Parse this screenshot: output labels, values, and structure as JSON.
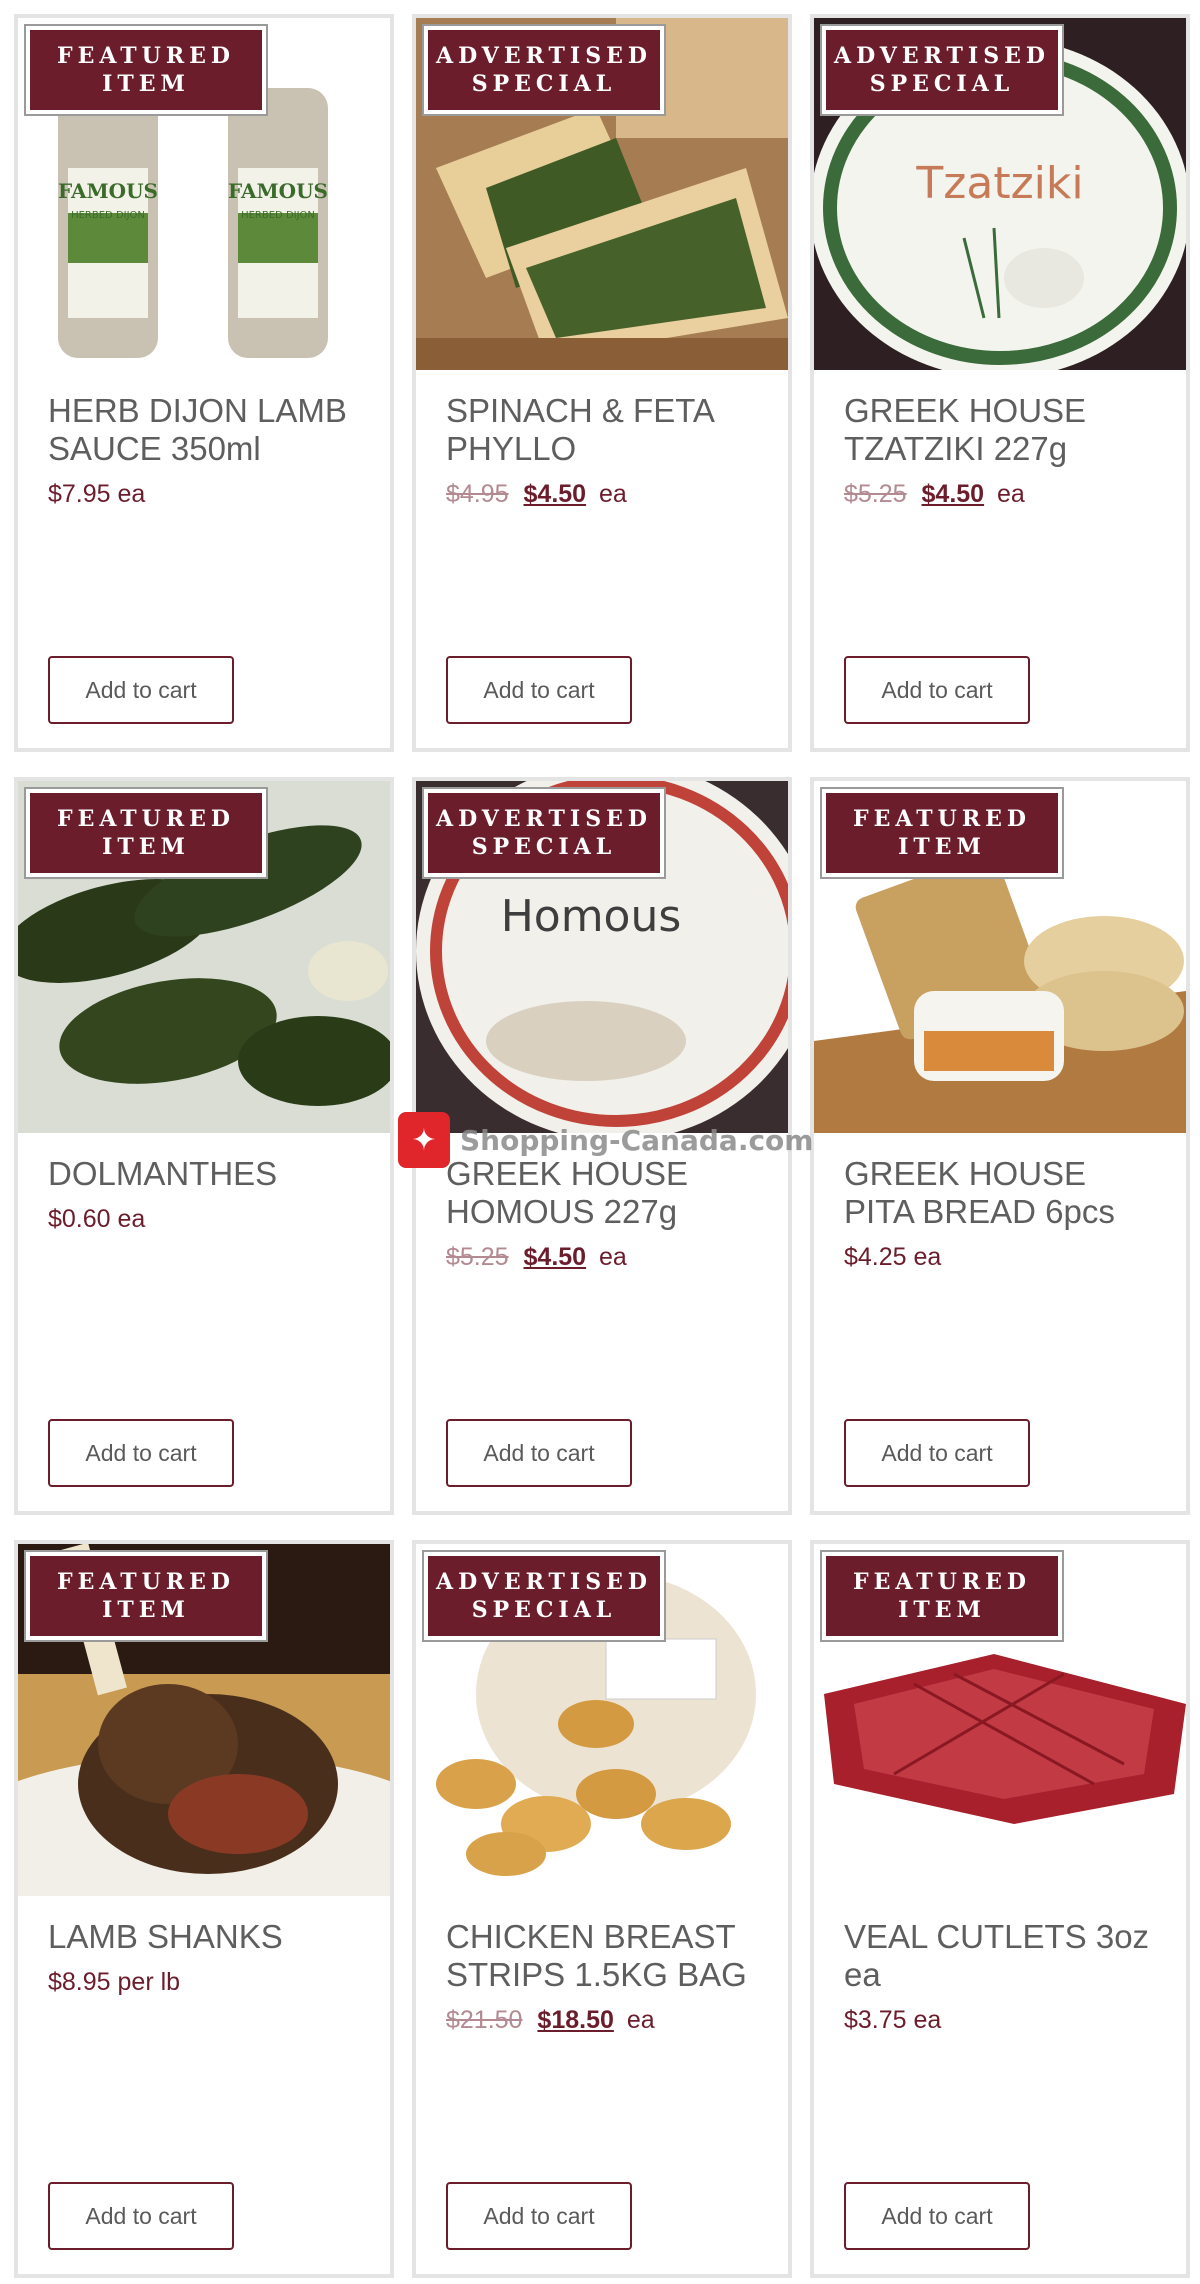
{
  "products": [
    {
      "badge1": "FEATURED",
      "badge2": "ITEM",
      "title": "HERB DIJON LAMB SAUCE 350ml",
      "old_price": "",
      "price": "$7.95",
      "unit": "ea",
      "cart": "Add to cart"
    },
    {
      "badge1": "ADVERTISED",
      "badge2": "SPECIAL",
      "title": "SPINACH & FETA PHYLLO",
      "old_price": "$4.95",
      "price": "$4.50",
      "unit": "ea",
      "cart": "Add to cart"
    },
    {
      "badge1": "ADVERTISED",
      "badge2": "SPECIAL",
      "title": "GREEK HOUSE TZATZIKI 227g",
      "old_price": "$5.25",
      "price": "$4.50",
      "unit": "ea",
      "cart": "Add to cart"
    },
    {
      "badge1": "FEATURED",
      "badge2": "ITEM",
      "title": "DOLMANTHES",
      "old_price": "",
      "price": "$0.60",
      "unit": "ea",
      "cart": "Add to cart"
    },
    {
      "badge1": "ADVERTISED",
      "badge2": "SPECIAL",
      "title": "GREEK HOUSE HOMOUS 227g",
      "old_price": "$5.25",
      "price": "$4.50",
      "unit": "ea",
      "cart": "Add to cart"
    },
    {
      "badge1": "FEATURED",
      "badge2": "ITEM",
      "title": "GREEK HOUSE PITA BREAD 6pcs",
      "old_price": "",
      "price": "$4.25",
      "unit": "ea",
      "cart": "Add to cart"
    },
    {
      "badge1": "FEATURED",
      "badge2": "ITEM",
      "title": "LAMB SHANKS",
      "old_price": "",
      "price": "$8.95",
      "unit": "per lb",
      "cart": "Add to cart"
    },
    {
      "badge1": "ADVERTISED",
      "badge2": "SPECIAL",
      "title": "CHICKEN BREAST STRIPS 1.5KG BAG",
      "old_price": "$21.50",
      "price": "$18.50",
      "unit": "ea",
      "cart": "Add to cart"
    },
    {
      "badge1": "FEATURED",
      "badge2": "ITEM",
      "title": "VEAL CUTLETS 3oz ea",
      "old_price": "",
      "price": "$3.75",
      "unit": "ea",
      "cart": "Add to cart"
    }
  ],
  "product_images": {
    "0": {
      "label_text": "FAMOUS",
      "label_sub": "HERBED DIJON"
    },
    "2": {
      "label_text": "Tzatziki"
    },
    "4": {
      "label_text": "Homous"
    }
  },
  "watermark": {
    "text": "Shopping-Canada.com",
    "icon": "maple-leaf-icon"
  },
  "colors": {
    "accent": "#6b1d2b",
    "border": "#e4e4e4",
    "text": "#5e5e5e"
  }
}
